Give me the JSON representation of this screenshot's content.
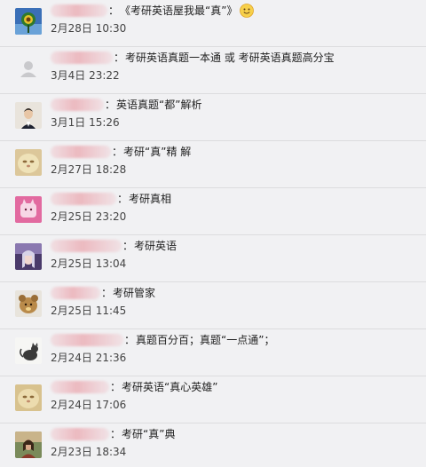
{
  "comments": [
    {
      "colon": "：",
      "message": "《考研英语屋我最“真”》",
      "time": "2月28日 10:30",
      "avatar_icon": "sunflower-avatar-icon",
      "emoji_icon": "smiling-face-icon"
    },
    {
      "colon": "：",
      "message": "考研英语真题一本通 或 考研英语真题高分宝",
      "time": "3月4日 23:22",
      "avatar_icon": "default-user-avatar-icon"
    },
    {
      "colon": "：",
      "message": "英语真题“都”解析",
      "time": "3月1日 15:26",
      "avatar_icon": "person-photo-avatar-icon"
    },
    {
      "colon": "：",
      "message": "考研“真”精 解",
      "time": "2月27日 18:28",
      "avatar_icon": "fluffy-dog-avatar-icon"
    },
    {
      "colon": "：",
      "message": "考研真相",
      "time": "2月25日 23:20",
      "avatar_icon": "pink-cartoon-avatar-icon"
    },
    {
      "colon": "：",
      "message": "考研英语",
      "time": "2月25日 13:04",
      "avatar_icon": "anime-avatar-icon"
    },
    {
      "colon": "：",
      "message": "考研管家",
      "time": "2月25日 11:45",
      "avatar_icon": "toy-dog-avatar-icon"
    },
    {
      "colon": "：",
      "message": "真题百分百；真题“一点通”；",
      "time": "2月24日 21:36",
      "avatar_icon": "cat-sketch-avatar-icon"
    },
    {
      "colon": "：",
      "message": "考研英语“真心英雄”",
      "time": "2月24日 17:06",
      "avatar_icon": "fluffy-dog-avatar-icon"
    },
    {
      "colon": "：",
      "message": "考研“真”典",
      "time": "2月23日 18:34",
      "avatar_icon": "landscape-avatar-icon"
    }
  ],
  "colors": {
    "background": "#f1f1f3",
    "divider": "#dcdcde",
    "redacted_name": "#e88c96"
  }
}
